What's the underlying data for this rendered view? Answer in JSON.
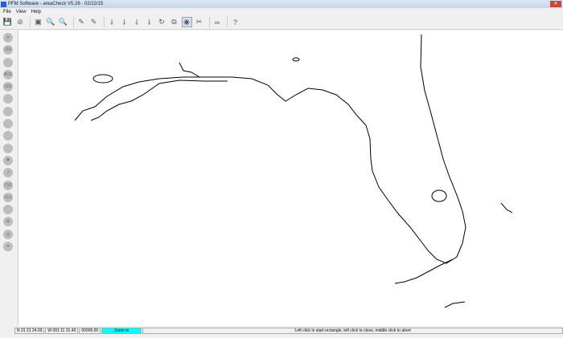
{
  "window": {
    "title": "PFM Software - areaCheck V5.28 - 02/22/15",
    "close": "✕"
  },
  "menu": [
    "File",
    "View",
    "Help"
  ],
  "toolbar": [
    {
      "name": "save-icon",
      "glyph": "💾"
    },
    {
      "name": "no-entry-icon",
      "glyph": "⊘"
    },
    {
      "sep": true
    },
    {
      "name": "briefcase-icon",
      "glyph": "▣"
    },
    {
      "name": "zoom-in-icon",
      "glyph": "🔍"
    },
    {
      "name": "zoom-out-icon",
      "glyph": "🔍"
    },
    {
      "sep": true
    },
    {
      "name": "pencil-icon",
      "glyph": "✎"
    },
    {
      "name": "pencil-delete-icon",
      "glyph": "✎"
    },
    {
      "sep": true
    },
    {
      "name": "point-icon",
      "glyph": "⸸"
    },
    {
      "name": "point-add-icon",
      "glyph": "⸸"
    },
    {
      "name": "point-move-icon",
      "glyph": "⸸"
    },
    {
      "name": "point-delete-icon",
      "glyph": "⸸"
    },
    {
      "name": "rotate-icon",
      "glyph": "↻"
    },
    {
      "name": "rectangles-icon",
      "glyph": "⧉"
    },
    {
      "name": "globe-icon",
      "glyph": "◉",
      "active": true
    },
    {
      "name": "tools-icon",
      "glyph": "✂"
    },
    {
      "sep": true
    },
    {
      "name": "link-icon",
      "glyph": "∞"
    },
    {
      "sep": true
    },
    {
      "name": "whats-this-help-icon",
      "glyph": "?"
    }
  ],
  "left_toolbar": [
    {
      "name": "close-circle-icon",
      "glyph": "✕"
    },
    {
      "name": "iss60-icon",
      "glyph": "ISS"
    },
    {
      "name": "circle-icon",
      "glyph": ""
    },
    {
      "name": "ace-icon",
      "glyph": "ACE"
    },
    {
      "name": "iss60-2-icon",
      "glyph": "ISS"
    },
    {
      "name": "circle-icon",
      "glyph": ""
    },
    {
      "name": "circle-icon",
      "glyph": ""
    },
    {
      "name": "circle-icon",
      "glyph": ""
    },
    {
      "name": "circle-icon",
      "glyph": ""
    },
    {
      "name": "circle-icon",
      "glyph": ""
    },
    {
      "name": "flag-icon",
      "glyph": "⚑"
    },
    {
      "name": "arrow-icon",
      "glyph": "↗"
    },
    {
      "name": "yxz-icon",
      "glyph": "YXZ"
    },
    {
      "name": "llz-icon",
      "glyph": "LLZ"
    },
    {
      "name": "circle-icon",
      "glyph": ""
    },
    {
      "name": "gear-icon",
      "glyph": "⚙"
    },
    {
      "name": "target-icon",
      "glyph": "◎"
    },
    {
      "name": "star-icon",
      "glyph": "✦"
    }
  ],
  "status": {
    "lat": "N 31 21 24.03",
    "lon": "W 091 11 31.40",
    "value": "00000.00",
    "mode": "Zoom in",
    "message": "Left click to start rectangle, left click to close, middle click to abort"
  },
  "colors": {
    "mode_bg": "#00ffff"
  }
}
